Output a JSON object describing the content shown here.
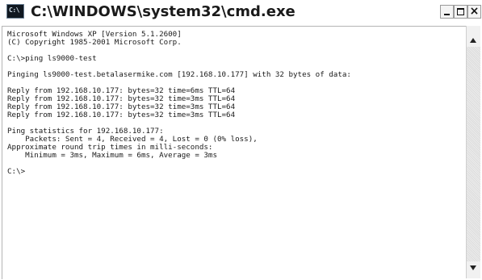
{
  "window": {
    "title": "C:\\WINDOWS\\system32\\cmd.exe",
    "icon": "console-icon",
    "icon_text": "C:\\"
  },
  "console": {
    "lines": [
      "Microsoft Windows XP [Version 5.1.2600]",
      "(C) Copyright 1985-2001 Microsoft Corp.",
      "C:\\>ping ls9000-test",
      "Pinging ls9000-test.betalasermike.com [192.168.10.177] with 32 bytes of data:",
      "Reply from 192.168.10.177: bytes=32 time=6ms TTL=64",
      "Reply from 192.168.10.177: bytes=32 time=3ms TTL=64",
      "Reply from 192.168.10.177: bytes=32 time=3ms TTL=64",
      "Reply from 192.168.10.177: bytes=32 time=3ms TTL=64",
      "Ping statistics for 192.168.10.177:",
      "    Packets: Sent = 4, Received = 4, Lost = 0 (0% loss),",
      "Approximate round trip times in milli-seconds:",
      "    Minimum = 3ms, Maximum = 6ms, Average = 3ms",
      "C:\\>"
    ]
  },
  "controls": {
    "minimize": "minimize-icon",
    "maximize": "maximize-icon",
    "close": "close-icon",
    "close_glyph": "×"
  }
}
